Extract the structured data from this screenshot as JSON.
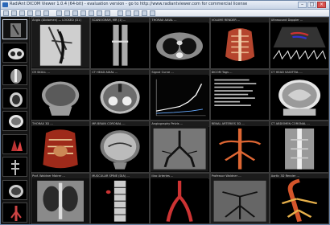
{
  "window": {
    "title": "RadiAnt DICOM Viewer 1.0.4 (64-bit) - evaluation version - go to http://www.radiantviewer.com for commercial license",
    "minimize_icon": "minimize-icon",
    "maximize_icon": "maximize-icon",
    "close_icon": "close-icon"
  },
  "toolbar": {
    "icons": [
      "open-folder-icon",
      "cd-icon",
      "save-icon",
      "series-icon",
      "layout-icon",
      "window-level-icon",
      "pan-icon",
      "zoom-icon",
      "measure-icon",
      "angle-icon",
      "ellipse-icon",
      "arrow-icon",
      "3d-icon",
      "mpr-icon",
      "rotate-icon",
      "flip-icon",
      "reset-icon",
      "help-icon"
    ]
  },
  "sidebar": {
    "thumbnails": [
      "thumb-1",
      "thumb-2",
      "thumb-3",
      "thumb-4",
      "thumb-5",
      "thumb-6",
      "thumb-7",
      "thumb-8",
      "thumb-9"
    ]
  },
  "viewports": [
    {
      "label": "Angio (Abdomen) — LOCKED (D1)"
    },
    {
      "label": "SCANOGRAM, MR (1) ..."
    },
    {
      "label": "THORAX AXIAL ..."
    },
    {
      "label": "VOLUME RENDER ..."
    },
    {
      "label": "Ultrasound Doppler ..."
    },
    {
      "label": "CR SKULL ..."
    },
    {
      "label": "CT HEAD AXIAL ..."
    },
    {
      "label": "Signal Curve ..."
    },
    {
      "label": "DICOM Tags ..."
    },
    {
      "label": "CT HEAD SAGITTAL ..."
    },
    {
      "label": "THORAX 3D ..."
    },
    {
      "label": "MR BRAIN CORONAL ..."
    },
    {
      "label": "Angiography Pelvis ..."
    },
    {
      "label": "RENAL ARTERIES 3D ..."
    },
    {
      "label": "CT ABDOMEN CORONAL ..."
    },
    {
      "label": "Prof. Waldner Mairer ..."
    },
    {
      "label": "MUSCULAR SPINE (DIA) ..."
    },
    {
      "label": "Iliac Arteries ..."
    },
    {
      "label": "Professor Waldner ..."
    },
    {
      "label": "Aortic 3D Render ..."
    }
  ]
}
